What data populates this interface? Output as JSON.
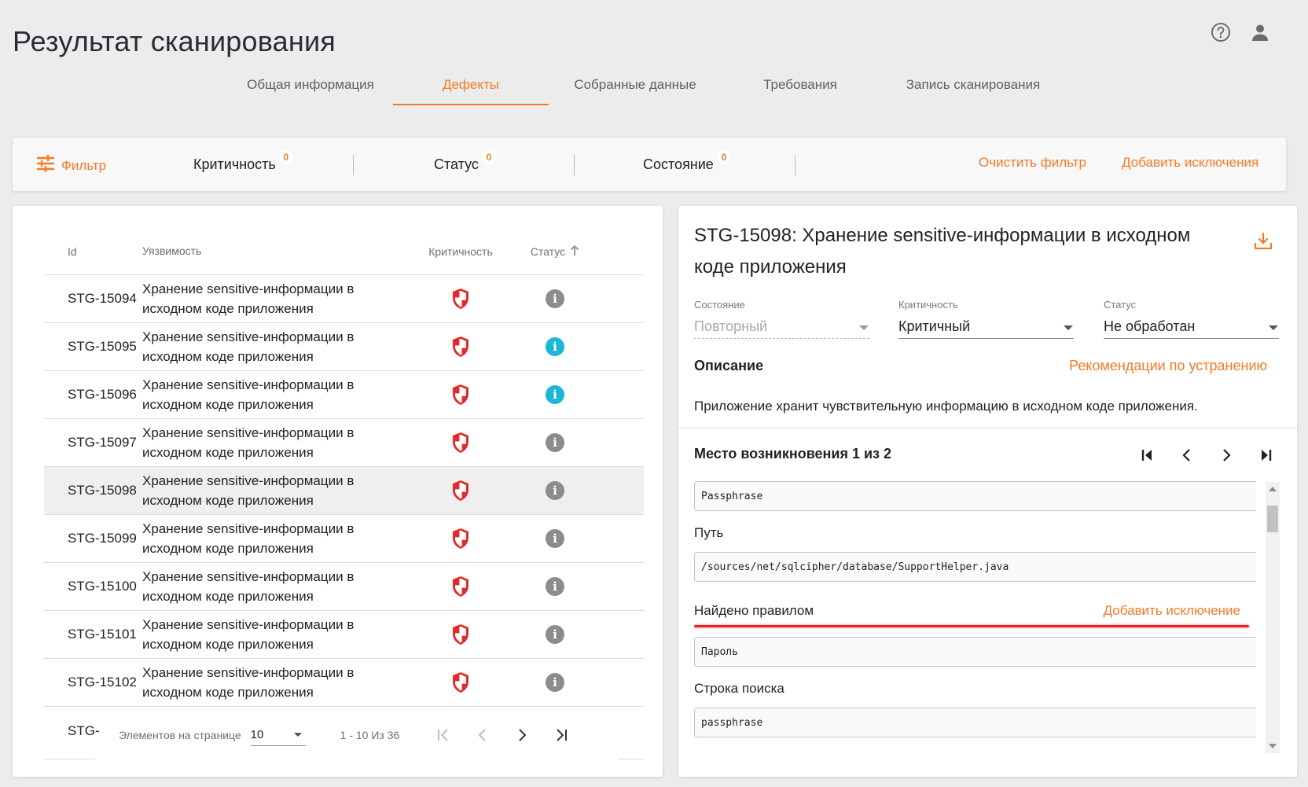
{
  "page": {
    "title": "Результат сканирования"
  },
  "top_icons": [
    "help-icon",
    "user-icon"
  ],
  "tabs": [
    {
      "label": "Общая информация",
      "active": false
    },
    {
      "label": "Дефекты",
      "active": true
    },
    {
      "label": "Собранные данные",
      "active": false
    },
    {
      "label": "Требования",
      "active": false
    },
    {
      "label": "Запись сканирования",
      "active": false
    }
  ],
  "filter": {
    "button_label": "Фильтр",
    "chips": [
      {
        "label": "Критичность",
        "count": "0"
      },
      {
        "label": "Статус",
        "count": "0"
      },
      {
        "label": "Состояние",
        "count": "0"
      }
    ],
    "clear_label": "Очистить фильтр",
    "add_exclusions_label": "Добавить исключения"
  },
  "table": {
    "headers": {
      "id": "Id",
      "vuln": "Уязвимость",
      "crit": "Критичность",
      "status": "Статус"
    },
    "rows": [
      {
        "id": "STG-15094",
        "vuln": "Хранение sensitive-информации в исходном коде приложения",
        "status": "grey"
      },
      {
        "id": "STG-15095",
        "vuln": "Хранение sensitive-информации в исходном коде приложения",
        "status": "blue"
      },
      {
        "id": "STG-15096",
        "vuln": "Хранение sensitive-информации в исходном коде приложения",
        "status": "blue"
      },
      {
        "id": "STG-15097",
        "vuln": "Хранение sensitive-информации в исходном коде приложения",
        "status": "grey"
      },
      {
        "id": "STG-15098",
        "vuln": "Хранение sensitive-информации в исходном коде приложения",
        "status": "grey"
      },
      {
        "id": "STG-15099",
        "vuln": "Хранение sensitive-информации в исходном коде приложения",
        "status": "grey"
      },
      {
        "id": "STG-15100",
        "vuln": "Хранение sensitive-информации в исходном коде приложения",
        "status": "grey"
      },
      {
        "id": "STG-15101",
        "vuln": "Хранение sensitive-информации в исходном коде приложения",
        "status": "grey"
      },
      {
        "id": "STG-15102",
        "vuln": "Хранение sensitive-информации в исходном коде приложения",
        "status": "grey"
      }
    ],
    "selected_id": "STG-15098",
    "partial_row_id": "STG-"
  },
  "pager": {
    "per_page_label": "Элементов на странице",
    "per_page_value": "10",
    "range": "1 - 10 Из 36"
  },
  "detail": {
    "title": "STG-15098: Хранение sensitive-информации в исходном коде приложения",
    "state": {
      "label": "Состояние",
      "value": "Повторный"
    },
    "criticality": {
      "label": "Критичность",
      "value": "Критичный"
    },
    "status": {
      "label": "Статус",
      "value": "Не обработан"
    },
    "description_heading": "Описание",
    "recommendations_link": "Рекомендации по устранению",
    "description_text": "Приложение хранит чувствительную информацию в исходном коде приложения.",
    "occurrence_heading": "Место возникновения 1 из 2",
    "match_value": "Passphrase",
    "path_label": "Путь",
    "path_value": "/sources/net/sqlcipher/database/SupportHelper.java",
    "rule_label": "Найдено правилом",
    "add_exclusion_label": "Добавить исключение",
    "rule_value": "Пароль",
    "search_label": "Строка поиска",
    "search_value": "passphrase"
  },
  "colors": {
    "accent": "#f47a26",
    "critical": "#e12b2b",
    "info_grey": "#8c8c8c",
    "info_blue": "#1db5d8",
    "annotation_red": "#e82028"
  }
}
